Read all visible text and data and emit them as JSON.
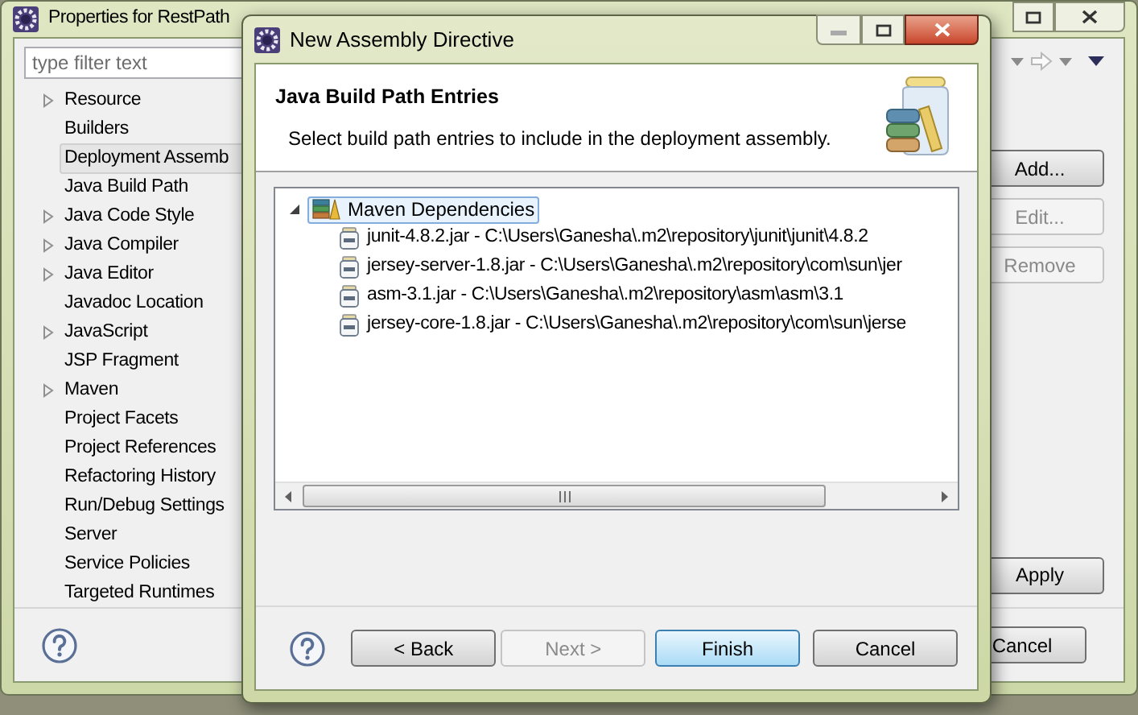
{
  "properties_window": {
    "title": "Properties for RestPath",
    "filter": {
      "placeholder": "type filter text"
    },
    "nav_items": [
      {
        "label": "Resource",
        "has_children": true,
        "selected": false
      },
      {
        "label": "Builders",
        "has_children": false,
        "selected": false
      },
      {
        "label": "Deployment Assemb",
        "has_children": false,
        "selected": true
      },
      {
        "label": "Java Build Path",
        "has_children": false,
        "selected": false
      },
      {
        "label": "Java Code Style",
        "has_children": true,
        "selected": false
      },
      {
        "label": "Java Compiler",
        "has_children": true,
        "selected": false
      },
      {
        "label": "Java Editor",
        "has_children": true,
        "selected": false
      },
      {
        "label": "Javadoc Location",
        "has_children": false,
        "selected": false
      },
      {
        "label": "JavaScript",
        "has_children": true,
        "selected": false
      },
      {
        "label": "JSP Fragment",
        "has_children": false,
        "selected": false
      },
      {
        "label": "Maven",
        "has_children": true,
        "selected": false
      },
      {
        "label": "Project Facets",
        "has_children": false,
        "selected": false
      },
      {
        "label": "Project References",
        "has_children": false,
        "selected": false
      },
      {
        "label": "Refactoring History",
        "has_children": false,
        "selected": false
      },
      {
        "label": "Run/Debug Settings",
        "has_children": false,
        "selected": false
      },
      {
        "label": "Server",
        "has_children": false,
        "selected": false
      },
      {
        "label": "Service Policies",
        "has_children": false,
        "selected": false
      },
      {
        "label": "Targeted Runtimes",
        "has_children": false,
        "selected": false
      }
    ],
    "side_buttons": [
      {
        "label": "Add...",
        "disabled": false
      },
      {
        "label": "Edit...",
        "disabled": true
      },
      {
        "label": "Remove",
        "disabled": true
      }
    ],
    "apply_button": "Apply",
    "cancel_button": "Cancel"
  },
  "dialog": {
    "title": "New Assembly Directive",
    "heading": "Java Build Path Entries",
    "description": "Select build path entries to include in the deployment assembly.",
    "tree": [
      {
        "label": "Maven Dependencies",
        "expanded": true,
        "selected": true,
        "children": [
          {
            "label": "junit-4.8.2.jar - C:\\Users\\Ganesha\\.m2\\repository\\junit\\junit\\4.8.2"
          },
          {
            "label": "jersey-server-1.8.jar - C:\\Users\\Ganesha\\.m2\\repository\\com\\sun\\jer"
          },
          {
            "label": "asm-3.1.jar - C:\\Users\\Ganesha\\.m2\\repository\\asm\\asm\\3.1"
          },
          {
            "label": "jersey-core-1.8.jar - C:\\Users\\Ganesha\\.m2\\repository\\com\\sun\\jerse"
          }
        ]
      }
    ],
    "buttons": [
      {
        "label": "< Back",
        "disabled": false,
        "default": false
      },
      {
        "label": "Next >",
        "disabled": true,
        "default": false
      },
      {
        "label": "Finish",
        "disabled": false,
        "default": true
      },
      {
        "label": "Cancel",
        "disabled": false,
        "default": false
      }
    ]
  }
}
